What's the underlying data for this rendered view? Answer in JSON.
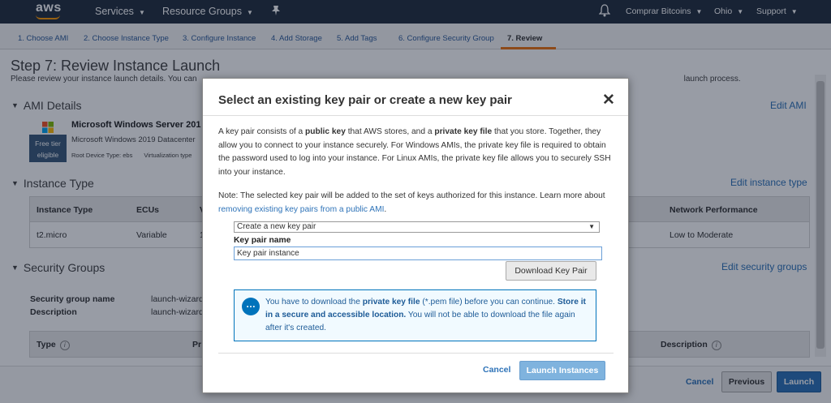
{
  "topnav": {
    "logo": "aws",
    "services": "Services",
    "resource_groups": "Resource Groups",
    "pin_icon": "pin-icon",
    "bell_icon": "bell-icon",
    "account": "Comprar Bitcoins",
    "region": "Ohio",
    "support": "Support"
  },
  "steps": [
    "1. Choose AMI",
    "2. Choose Instance Type",
    "3. Configure Instance",
    "4. Add Storage",
    "5. Add Tags",
    "6. Configure Security Group",
    "7. Review"
  ],
  "page": {
    "title": "Step 7: Review Instance Launch",
    "subtitle_start": "Please review your instance launch details. You can",
    "subtitle_end": "launch process."
  },
  "ami": {
    "heading": "AMI Details",
    "edit": "Edit AMI",
    "name": "Microsoft Windows Server 201",
    "desc": "Microsoft Windows 2019 Datacenter",
    "free_tier_line1": "Free tier",
    "free_tier_line2": "eligible",
    "meta_root": "Root Device Type: ebs",
    "meta_virt": "Virtualization type"
  },
  "instance_type": {
    "heading": "Instance Type",
    "edit": "Edit instance type",
    "headers": [
      "Instance Type",
      "ECUs",
      "V",
      "Network Performance"
    ],
    "row": [
      "t2.micro",
      "Variable",
      "1",
      "Low to Moderate"
    ]
  },
  "security_groups": {
    "heading": "Security Groups",
    "edit": "Edit security groups",
    "name_label": "Security group name",
    "name_value": "launch-wizard",
    "desc_label": "Description",
    "desc_value": "launch-wizard",
    "col_type": "Type",
    "col_pr": "Pr",
    "col_desc": "Description"
  },
  "footer": {
    "cancel": "Cancel",
    "previous": "Previous",
    "launch": "Launch"
  },
  "modal": {
    "title": "Select an existing key pair or create a new key pair",
    "close": "✕",
    "para_1": "A key pair consists of a ",
    "para_b1": "public key",
    "para_2": " that AWS stores, and a ",
    "para_b2": "private key file",
    "para_3": " that you store. Together, they allow you to connect to your instance securely. For Windows AMIs, the private key file is required to obtain the password used to log into your instance. For Linux AMIs, the private key file allows you to securely SSH into your instance.",
    "note_1": "Note: The selected key pair will be added to the set of keys authorized for this instance. Learn more about ",
    "note_link": "removing existing key pairs from a public AMI",
    "note_2": ".",
    "select_value": "Create a new key pair",
    "key_label": "Key pair name",
    "key_value": "Key pair instance",
    "download": "Download Key Pair",
    "info_1": "You have to download the ",
    "info_b1": "private key file",
    "info_2": " (*.pem file) before you can continue. ",
    "info_b2": "Store it in a secure and accessible location.",
    "info_3": " You will not be able to download the file again after it's created.",
    "cancel": "Cancel",
    "launch": "Launch Instances"
  }
}
